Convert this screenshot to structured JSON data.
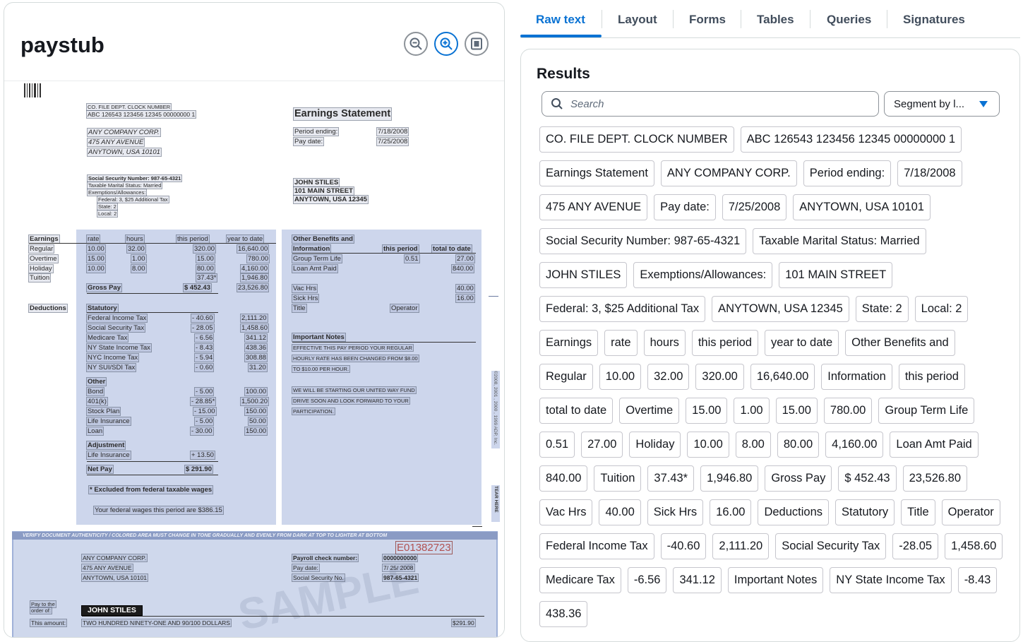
{
  "document": {
    "title": "paystub"
  },
  "scan": {
    "company_codes_header": "CO.  FILE  DEPT.  CLOCK  NUMBER",
    "company_codes_values": "ABC  126543  123456  12345  00000000  1",
    "company_name": "ANY COMPANY CORP.",
    "company_street": "475 ANY AVENUE",
    "company_city": "ANYTOWN, USA 10101",
    "statement_title": "Earnings Statement",
    "period_ending_label": "Period ending:",
    "period_ending_value": "7/18/2008",
    "pay_date_label": "Pay date:",
    "pay_date_value": "7/25/2008",
    "ssn_line": "Social Security Number: 987-65-4321",
    "marital_line": "Taxable Marital Status: Married",
    "exemptions_line": "Exemptions/Allowances:",
    "federal_line": "Federal: 3, $25 Additional Tax",
    "state_line": "State:   2",
    "local_line": "Local:   2",
    "employee_name": "JOHN STILES",
    "employee_street": "101 MAIN STREET",
    "employee_city": "ANYTOWN, USA 12345",
    "earnings_label": "Earnings",
    "col_rate": "rate",
    "col_hours": "hours",
    "col_this_period": "this period",
    "col_year_to_date": "year to date",
    "earn_regular": [
      "Regular",
      "10.00",
      "32.00",
      "320.00",
      "16,640.00"
    ],
    "earn_overtime": [
      "Overtime",
      "15.00",
      "1.00",
      "15.00",
      "780.00"
    ],
    "earn_holiday": [
      "Holiday",
      "10.00",
      "8.00",
      "80.00",
      "4,160.00"
    ],
    "earn_tuition": [
      "Tuition",
      "37.43*",
      "1,946.80"
    ],
    "gross_pay": [
      "Gross Pay",
      "$ 452.43",
      "23,526.80"
    ],
    "deductions_label": "Deductions",
    "statutory_label": "Statutory",
    "statutory_rows": [
      [
        "Federal Income Tax",
        "- 40.60",
        "2,111.20"
      ],
      [
        "Social Security Tax",
        "- 28.05",
        "1,458.60"
      ],
      [
        "Medicare Tax",
        "- 6.56",
        "341.12"
      ],
      [
        "NY State Income Tax",
        "- 8.43",
        "438.36"
      ],
      [
        "NYC Income Tax",
        "- 5.94",
        "308.88"
      ],
      [
        "NY SUI/SDI Tax",
        "- 0.60",
        "31.20"
      ]
    ],
    "other_label": "Other",
    "other_rows": [
      [
        "Bond",
        "- 5.00",
        "100.00"
      ],
      [
        "401(k)",
        "- 28.85*",
        "1,500.20"
      ],
      [
        "Stock Plan",
        "- 15.00",
        "150.00"
      ],
      [
        "Life Insurance",
        "- 5.00",
        "50.00"
      ],
      [
        "Loan",
        "- 30.00",
        "150.00"
      ]
    ],
    "adjustment_label": "Adjustment",
    "adjustment_row": [
      "Life Insurance",
      "+ 13.50"
    ],
    "net_pay": [
      "Net Pay",
      "$ 291.90"
    ],
    "excluded_note": "* Excluded from federal taxable wages",
    "federal_wages_note": "Your federal wages this period are $386.15",
    "benefits_label_1": "Other Benefits and",
    "benefits_label_2": "Information",
    "col_total_to_date": "total to date",
    "benefit_group_term": [
      "Group Term Life",
      "0.51",
      "27.00"
    ],
    "benefit_loan_amt": [
      "Loan Amt Paid",
      "840.00"
    ],
    "benefit_vac": [
      "Vac Hrs",
      "40.00"
    ],
    "benefit_sick": [
      "Sick Hrs",
      "16.00"
    ],
    "benefit_title": [
      "Title",
      "Operator"
    ],
    "important_notes_label": "Important Notes",
    "notes_lines": [
      "EFFECTIVE THIS PAY PERIOD YOUR REGULAR",
      "HOURLY RATE HAS BEEN CHANGED FROM $8.00",
      "TO $10.00 PER HOUR.",
      "WE WILL BE STARTING OUR UNITED WAY FUND",
      "DRIVE SOON AND LOOK FORWARD TO YOUR",
      "PARTICIPATION."
    ],
    "copyright_side": "©2008, 2001 , 2000 , 1999 ADP, Inc.",
    "tear_here": "TEAR HERE",
    "check_band": "VERIFY DOCUMENT AUTHENTICITY / COLORED AREA MUST CHANGE IN TONE GRADUALLY AND EVENLY FROM DARK AT TOP TO LIGHTER AT BOTTOM",
    "check_serial": "E01382723",
    "check_company_name": "ANY COMPANY CORP.",
    "check_company_street": "475  ANY  AVENUE",
    "check_company_city": "ANYTOWN,  USA  10101",
    "check_number_label": "Payroll  check  number:",
    "check_number_value": "0000000000",
    "check_pay_date_label": "Pay  date:",
    "check_pay_date_value": "7/ 25/ 2008",
    "check_ssn_label": "Social  Security  No.",
    "check_ssn_value": "987-65-4321",
    "pay_to_order_1": "Pay to the",
    "pay_to_order_2": "order of:",
    "check_payee": "JOHN  STILES",
    "this_amount_label": "This  amount:",
    "amount_words": "TWO  HUNDRED  NINETY-ONE  AND  90/100  DOLLARS",
    "amount_numeric": "$291.90",
    "watermark": "SAMPLE"
  },
  "tabs": [
    "Raw text",
    "Layout",
    "Forms",
    "Tables",
    "Queries",
    "Signatures"
  ],
  "results": {
    "title": "Results",
    "search_placeholder": "Search",
    "segment_label": "Segment by l...",
    "tokens": [
      "CO. FILE DEPT. CLOCK NUMBER",
      "ABC 126543 123456 12345 00000000 1",
      "Earnings Statement",
      "ANY COMPANY CORP.",
      "Period ending:",
      "7/18/2008",
      "475 ANY AVENUE",
      "Pay date:",
      "7/25/2008",
      "ANYTOWN, USA 10101",
      "Social Security Number: 987-65-4321",
      "Taxable Marital Status: Married",
      "JOHN STILES",
      "Exemptions/Allowances:",
      "101 MAIN STREET",
      "Federal: 3, $25 Additional Tax",
      "ANYTOWN, USA 12345",
      "State: 2",
      "Local: 2",
      "Earnings",
      "rate",
      "hours",
      "this period",
      "year to date",
      "Other Benefits and",
      "Regular",
      "10.00",
      "32.00",
      "320.00",
      "16,640.00",
      "Information",
      "this period",
      "total to date",
      "Overtime",
      "15.00",
      "1.00",
      "15.00",
      "780.00",
      "Group Term Life",
      "0.51",
      "27.00",
      "Holiday",
      "10.00",
      "8.00",
      "80.00",
      "4,160.00",
      "Loan Amt Paid",
      "840.00",
      "Tuition",
      "37.43*",
      "1,946.80",
      "Gross Pay",
      "$ 452.43",
      "23,526.80",
      "Vac Hrs",
      "40.00",
      "Sick Hrs",
      "16.00",
      "Deductions",
      "Statutory",
      "Title",
      "Operator",
      "Federal Income Tax",
      "-40.60",
      "2,111.20",
      "Social Security Tax",
      "-28.05",
      "1,458.60",
      "Medicare Tax",
      "-6.56",
      "341.12",
      "Important Notes",
      "NY State Income Tax",
      "-8.43",
      "438.36"
    ]
  },
  "icons": {
    "zoom_out": "zoom-out-icon",
    "zoom_in": "zoom-in-icon",
    "fit_page": "fit-page-icon",
    "search": "search-icon",
    "dropdown": "caret-down-icon",
    "barcode": "barcode-icon"
  },
  "colors": {
    "accent": "#0972d3",
    "overlay": "#cdd6ec",
    "border": "#d5dbdb"
  }
}
